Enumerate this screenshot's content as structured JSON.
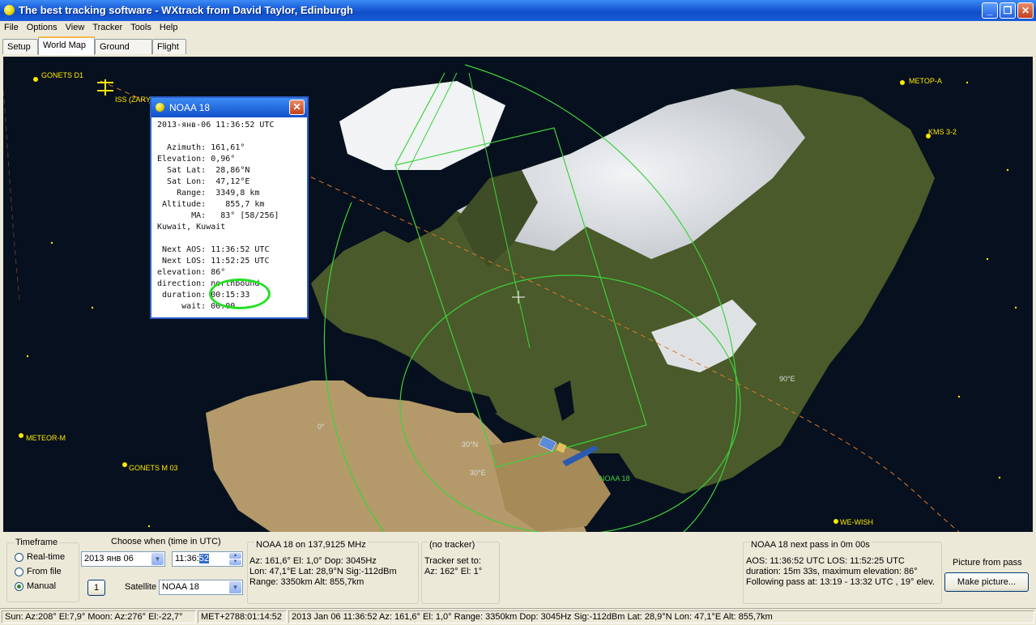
{
  "window": {
    "title": "The best tracking software - WXtrack from David Taylor, Edinburgh",
    "min": "_",
    "max": "❐",
    "close": "✕"
  },
  "menu": [
    "File",
    "Options",
    "View",
    "Tracker",
    "Tools",
    "Help"
  ],
  "tabs": [
    "Setup",
    "World Map",
    "Ground Path",
    "Flight"
  ],
  "map": {
    "satellites": {
      "gonets_d1": "GONETS D1",
      "iss": "ISS (ZARYA)",
      "metop_a": "METOP-A",
      "kms": "KMS 3-2",
      "meteor_m": "METEOR-M",
      "gonets_m03": "GONETS M 03",
      "we_wish": "WE-WISH",
      "noaa18": "NOAA 18"
    },
    "grid": {
      "lat30_left": "30°N",
      "lon30": "30°E",
      "lon0": "0°",
      "lon90": "90°E"
    }
  },
  "popup": {
    "title": "NOAA 18",
    "close": "✕",
    "lines": [
      "2013-янв-06 11:36:52 UTC",
      "",
      "  Azimuth: 161,61°",
      "Elevation: 0,96°",
      "  Sat Lat:  28,86°N",
      "  Sat Lon:  47,12°E",
      "    Range:  3349,8 km",
      " Altitude:    855,7 km",
      "       MA:   83° [58/256]",
      "Kuwait, Kuwait",
      "",
      " Next AOS: 11:36:52 UTC",
      " Next LOS: 11:52:25 UTC",
      "elevation: 86°",
      "direction: northbound",
      " duration: 00:15:33",
      "     wait: 00:00"
    ]
  },
  "timeframe": {
    "label": "Timeframe",
    "options": [
      "Real-time",
      "From file",
      "Manual"
    ],
    "selected": "Manual",
    "step_btn": "1"
  },
  "choose": {
    "label": "Choose when (time in UTC)",
    "date_value": "2013 янв 06",
    "time_value_a": "11:36:",
    "time_value_b": "52",
    "satellite_label": "Satellite",
    "satellite_value": "NOAA 18"
  },
  "sat_info": {
    "title": "NOAA 18 on 137,9125 MHz",
    "lines": [
      "Az: 161,6°  El: 1,0°  Dop: 3045Hz",
      "Lon: 47,1°E  Lat: 28,9°N  Sig:-112dBm",
      "Range: 3350km  Alt: 855,7km"
    ]
  },
  "tracker": {
    "title": "(no tracker)",
    "lines": [
      "Tracker set to:",
      "Az: 162°  El: 1°"
    ]
  },
  "next_pass": {
    "title": "NOAA 18 next pass in 0m 00s",
    "lines": [
      "AOS: 11:36:52 UTC  LOS: 11:52:25 UTC",
      "duration: 15m 33s,  maximum elevation: 86°",
      "Following pass at: 13:19 - 13:32 UTC , 19° elev."
    ]
  },
  "picture": {
    "label": "Picture from pass",
    "button": "Make picture..."
  },
  "status": {
    "sun": "Sun: Az:208° El:7,9°  Moon: Az:276° El:-22,7°",
    "met": "MET+2788:01:14:52",
    "details": "2013 Jan 06  11:36:52  Az: 161,6°  El: 1,0°  Range: 3350km  Dop: 3045Hz  Sig:-112dBm  Lat: 28,9°N  Lon: 47,1°E  Alt: 855,7km"
  }
}
